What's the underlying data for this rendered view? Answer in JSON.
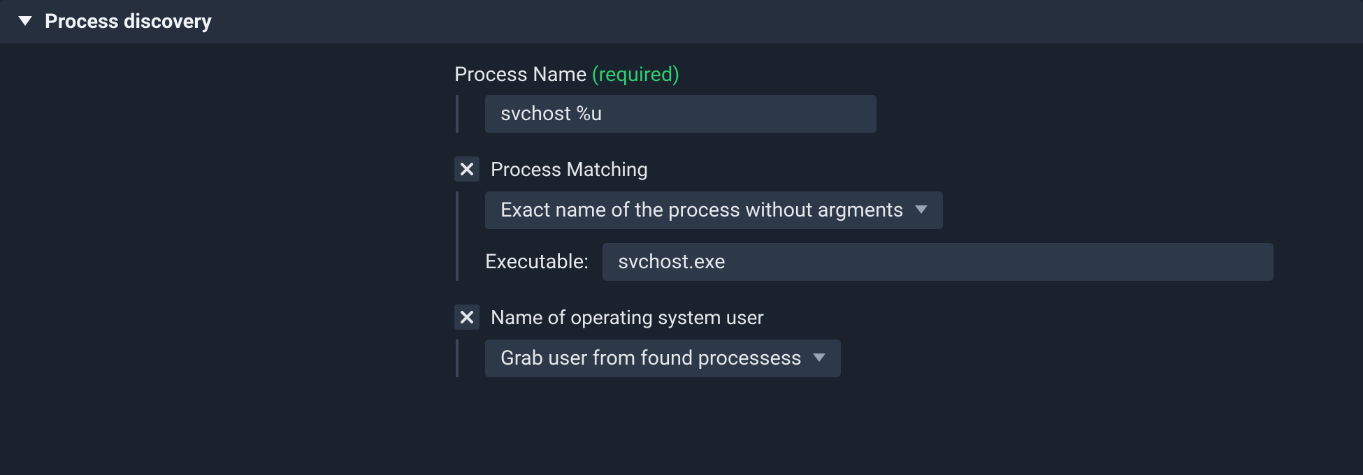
{
  "panel": {
    "title": "Process discovery"
  },
  "process_name": {
    "label": "Process Name",
    "required_text": "(required)",
    "value": "svchost %u"
  },
  "process_matching": {
    "label": "Process Matching",
    "selected": "Exact name of the process without argments",
    "executable_label": "Executable:",
    "executable_value": "svchost.exe"
  },
  "os_user": {
    "label": "Name of operating system user",
    "selected": "Grab user from found processess"
  }
}
